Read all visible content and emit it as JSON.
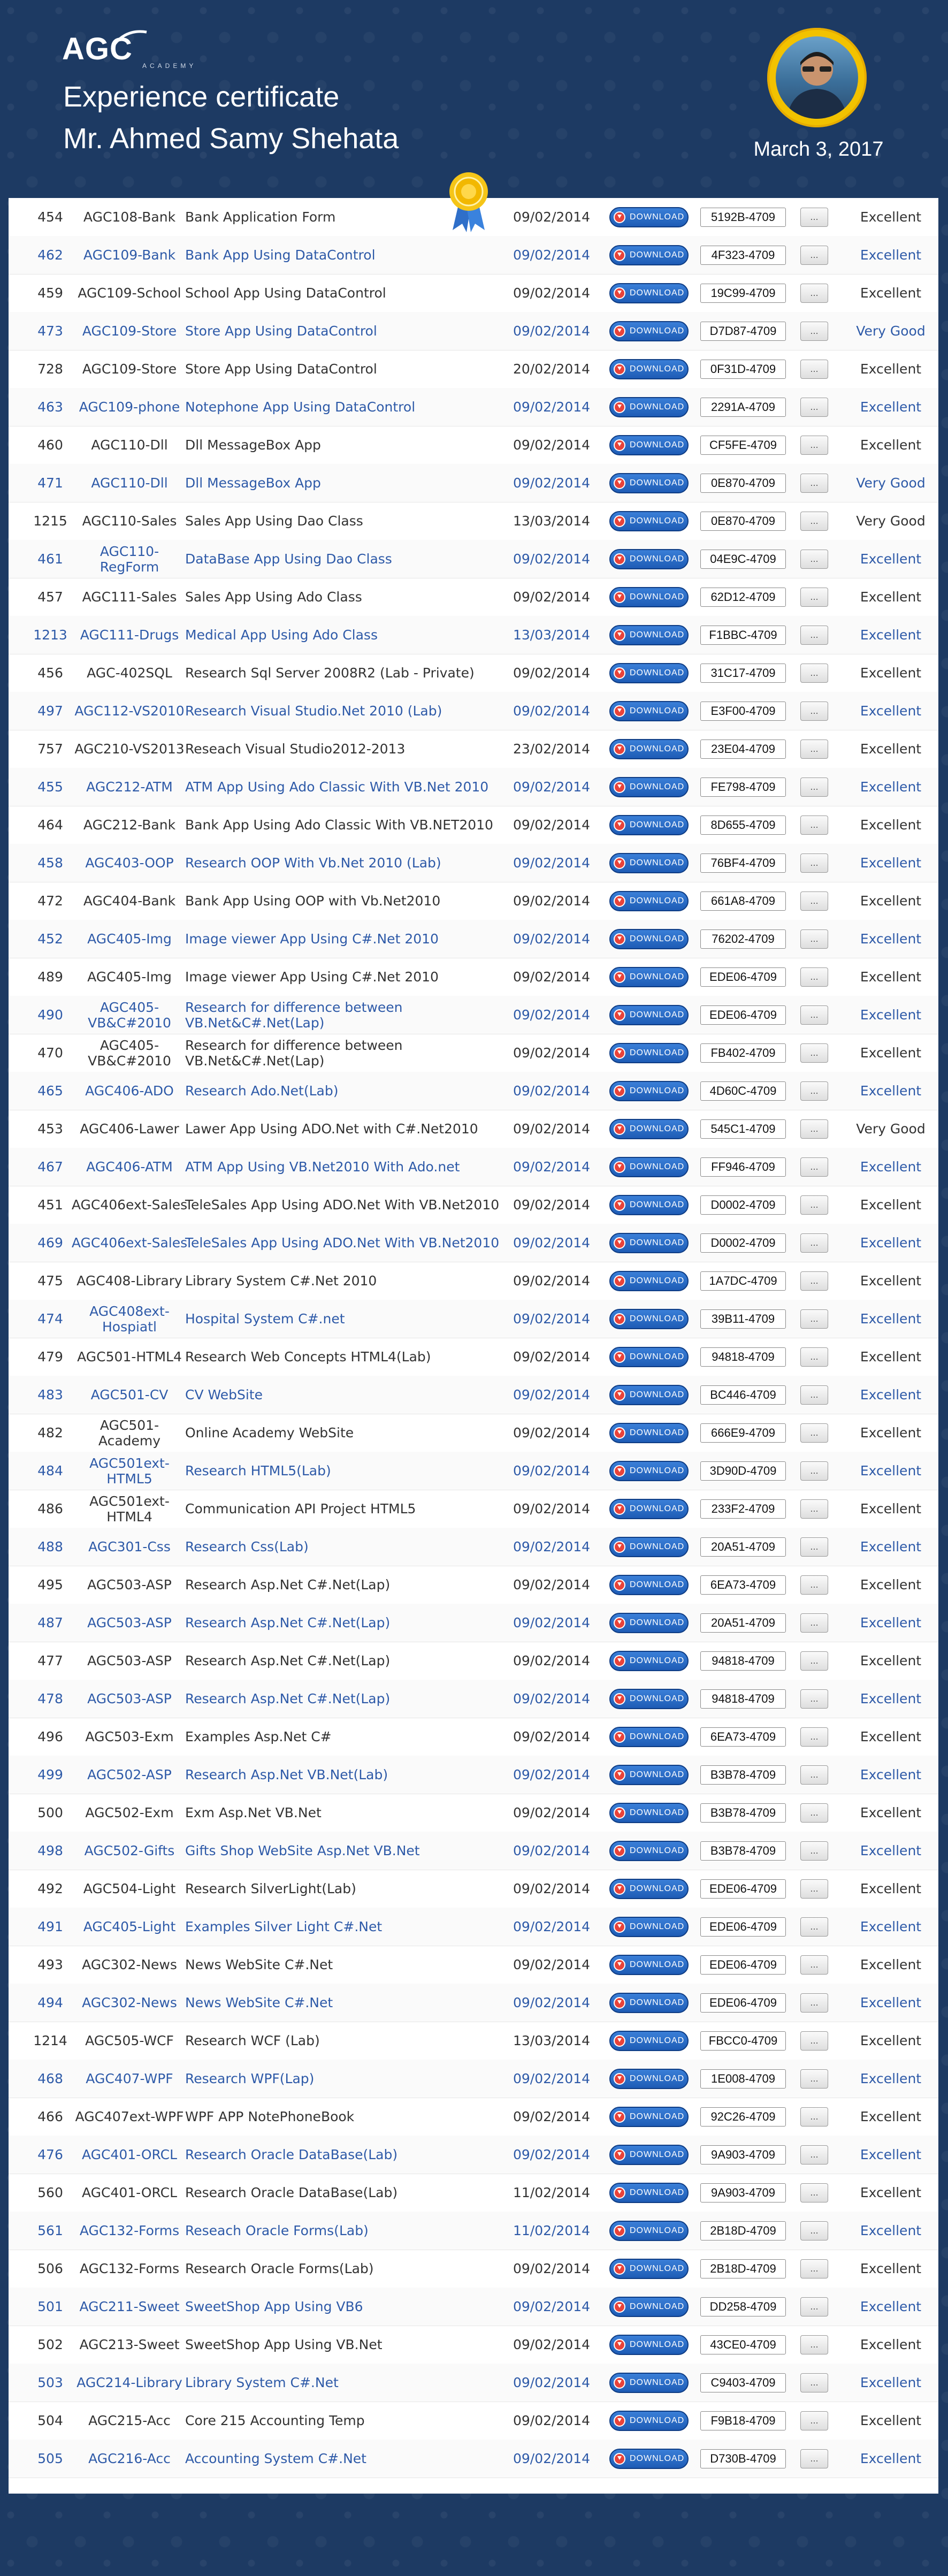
{
  "header": {
    "logo_text": "AGC",
    "logo_sub": "ACADEMY",
    "title_line1": "Experience certificate",
    "title_line2": "Mr. Ahmed Samy Shehata",
    "date": "March 3, 2017"
  },
  "table": {
    "download_label": "DOWNLOAD",
    "more_label": "...",
    "rows": [
      {
        "id": "454",
        "code": "AGC108-Bank",
        "name": "Bank Application Form",
        "date": "09/02/2014",
        "serial": "5192B-4709",
        "grade": "Excellent",
        "blue": false
      },
      {
        "id": "462",
        "code": "AGC109-Bank",
        "name": "Bank App Using DataControl",
        "date": "09/02/2014",
        "serial": "4F323-4709",
        "grade": "Excellent",
        "blue": true
      },
      {
        "id": "459",
        "code": "AGC109-School",
        "name": "School App Using DataControl",
        "date": "09/02/2014",
        "serial": "19C99-4709",
        "grade": "Excellent",
        "blue": false
      },
      {
        "id": "473",
        "code": "AGC109-Store",
        "name": "Store App Using DataControl",
        "date": "09/02/2014",
        "serial": "D7D87-4709",
        "grade": "Very Good",
        "blue": true
      },
      {
        "id": "728",
        "code": "AGC109-Store",
        "name": "Store App Using DataControl",
        "date": "20/02/2014",
        "serial": "0F31D-4709",
        "grade": "Excellent",
        "blue": false
      },
      {
        "id": "463",
        "code": "AGC109-phone",
        "name": "Notephone App Using DataControl",
        "date": "09/02/2014",
        "serial": "2291A-4709",
        "grade": "Excellent",
        "blue": true
      },
      {
        "id": "460",
        "code": "AGC110-Dll",
        "name": "Dll MessageBox App",
        "date": "09/02/2014",
        "serial": "CF5FE-4709",
        "grade": "Excellent",
        "blue": false
      },
      {
        "id": "471",
        "code": "AGC110-Dll",
        "name": "Dll MessageBox App",
        "date": "09/02/2014",
        "serial": "0E870-4709",
        "grade": "Very Good",
        "blue": true
      },
      {
        "id": "1215",
        "code": "AGC110-Sales",
        "name": "Sales App Using Dao Class",
        "date": "13/03/2014",
        "serial": "0E870-4709",
        "grade": "Very Good",
        "blue": false
      },
      {
        "id": "461",
        "code": "AGC110-RegForm",
        "name": "DataBase App Using Dao Class",
        "date": "09/02/2014",
        "serial": "04E9C-4709",
        "grade": "Excellent",
        "blue": true
      },
      {
        "id": "457",
        "code": "AGC111-Sales",
        "name": "Sales App Using Ado Class",
        "date": "09/02/2014",
        "serial": "62D12-4709",
        "grade": "Excellent",
        "blue": false
      },
      {
        "id": "1213",
        "code": "AGC111-Drugs",
        "name": "Medical App Using Ado Class",
        "date": "13/03/2014",
        "serial": "F1BBC-4709",
        "grade": "Excellent",
        "blue": true
      },
      {
        "id": "456",
        "code": "AGC-402SQL",
        "name": "Research Sql Server 2008R2 (Lab - Private)",
        "date": "09/02/2014",
        "serial": "31C17-4709",
        "grade": "Excellent",
        "blue": false
      },
      {
        "id": "497",
        "code": "AGC112-VS2010",
        "name": "Research Visual Studio.Net 2010 (Lab)",
        "date": "09/02/2014",
        "serial": "E3F00-4709",
        "grade": "Excellent",
        "blue": true
      },
      {
        "id": "757",
        "code": "AGC210-VS2013",
        "name": "Reseach Visual Studio2012-2013",
        "date": "23/02/2014",
        "serial": "23E04-4709",
        "grade": "Excellent",
        "blue": false
      },
      {
        "id": "455",
        "code": "AGC212-ATM",
        "name": "ATM App Using Ado Classic With VB.Net 2010",
        "date": "09/02/2014",
        "serial": "FE798-4709",
        "grade": "Excellent",
        "blue": true
      },
      {
        "id": "464",
        "code": "AGC212-Bank",
        "name": "Bank App Using Ado Classic With VB.NET2010",
        "date": "09/02/2014",
        "serial": "8D655-4709",
        "grade": "Excellent",
        "blue": false
      },
      {
        "id": "458",
        "code": "AGC403-OOP",
        "name": "Research OOP With Vb.Net 2010 (Lab)",
        "date": "09/02/2014",
        "serial": "76BF4-4709",
        "grade": "Excellent",
        "blue": true
      },
      {
        "id": "472",
        "code": "AGC404-Bank",
        "name": "Bank App Using OOP with Vb.Net2010",
        "date": "09/02/2014",
        "serial": "661A8-4709",
        "grade": "Excellent",
        "blue": false
      },
      {
        "id": "452",
        "code": "AGC405-Img",
        "name": "Image viewer App Using C#.Net 2010",
        "date": "09/02/2014",
        "serial": "76202-4709",
        "grade": "Excellent",
        "blue": true
      },
      {
        "id": "489",
        "code": "AGC405-Img",
        "name": "Image viewer App Using C#.Net 2010",
        "date": "09/02/2014",
        "serial": "EDE06-4709",
        "grade": "Excellent",
        "blue": false
      },
      {
        "id": "490",
        "code": "AGC405-VB&C#2010",
        "name": "Research for difference between VB.Net&C#.Net(Lap)",
        "date": "09/02/2014",
        "serial": "EDE06-4709",
        "grade": "Excellent",
        "blue": true
      },
      {
        "id": "470",
        "code": "AGC405-VB&C#2010",
        "name": "Research for difference between VB.Net&C#.Net(Lap)",
        "date": "09/02/2014",
        "serial": "FB402-4709",
        "grade": "Excellent",
        "blue": false
      },
      {
        "id": "465",
        "code": "AGC406-ADO",
        "name": "Research Ado.Net(Lab)",
        "date": "09/02/2014",
        "serial": "4D60C-4709",
        "grade": "Excellent",
        "blue": true
      },
      {
        "id": "453",
        "code": "AGC406-Lawer",
        "name": "Lawer App Using ADO.Net with C#.Net2010",
        "date": "09/02/2014",
        "serial": "545C1-4709",
        "grade": "Very Good",
        "blue": false
      },
      {
        "id": "467",
        "code": "AGC406-ATM",
        "name": "ATM App Using VB.Net2010 With Ado.net",
        "date": "09/02/2014",
        "serial": "FF946-4709",
        "grade": "Excellent",
        "blue": true
      },
      {
        "id": "451",
        "code": "AGC406ext-Sales",
        "name": "TeleSales App Using ADO.Net With VB.Net2010",
        "date": "09/02/2014",
        "serial": "D0002-4709",
        "grade": "Excellent",
        "blue": false
      },
      {
        "id": "469",
        "code": "AGC406ext-Sales",
        "name": "TeleSales App Using ADO.Net With VB.Net2010",
        "date": "09/02/2014",
        "serial": "D0002-4709",
        "grade": "Excellent",
        "blue": true
      },
      {
        "id": "475",
        "code": "AGC408-Library",
        "name": "Library System C#.Net 2010",
        "date": "09/02/2014",
        "serial": "1A7DC-4709",
        "grade": "Excellent",
        "blue": false
      },
      {
        "id": "474",
        "code": "AGC408ext-Hospiatl",
        "name": "Hospital System C#.net",
        "date": "09/02/2014",
        "serial": "39B11-4709",
        "grade": "Excellent",
        "blue": true
      },
      {
        "id": "479",
        "code": "AGC501-HTML4",
        "name": "Research Web Concepts HTML4(Lab)",
        "date": "09/02/2014",
        "serial": "94818-4709",
        "grade": "Excellent",
        "blue": false
      },
      {
        "id": "483",
        "code": "AGC501-CV",
        "name": "CV WebSite",
        "date": "09/02/2014",
        "serial": "BC446-4709",
        "grade": "Excellent",
        "blue": true
      },
      {
        "id": "482",
        "code": "AGC501-Academy",
        "name": "Online Academy WebSite",
        "date": "09/02/2014",
        "serial": "666E9-4709",
        "grade": "Excellent",
        "blue": false
      },
      {
        "id": "484",
        "code": "AGC501ext-HTML5",
        "name": "Research HTML5(Lab)",
        "date": "09/02/2014",
        "serial": "3D90D-4709",
        "grade": "Excellent",
        "blue": true
      },
      {
        "id": "486",
        "code": "AGC501ext-HTML4",
        "name": "Communication API Project HTML5",
        "date": "09/02/2014",
        "serial": "233F2-4709",
        "grade": "Excellent",
        "blue": false
      },
      {
        "id": "488",
        "code": "AGC301-Css",
        "name": "Research Css(Lab)",
        "date": "09/02/2014",
        "serial": "20A51-4709",
        "grade": "Excellent",
        "blue": true
      },
      {
        "id": "495",
        "code": "AGC503-ASP",
        "name": "Research Asp.Net C#.Net(Lap)",
        "date": "09/02/2014",
        "serial": "6EA73-4709",
        "grade": "Excellent",
        "blue": false
      },
      {
        "id": "487",
        "code": "AGC503-ASP",
        "name": "Research Asp.Net C#.Net(Lap)",
        "date": "09/02/2014",
        "serial": "20A51-4709",
        "grade": "Excellent",
        "blue": true
      },
      {
        "id": "477",
        "code": "AGC503-ASP",
        "name": "Research Asp.Net C#.Net(Lap)",
        "date": "09/02/2014",
        "serial": "94818-4709",
        "grade": "Excellent",
        "blue": false
      },
      {
        "id": "478",
        "code": "AGC503-ASP",
        "name": "Research Asp.Net C#.Net(Lap)",
        "date": "09/02/2014",
        "serial": "94818-4709",
        "grade": "Excellent",
        "blue": true
      },
      {
        "id": "496",
        "code": "AGC503-Exm",
        "name": "Examples Asp.Net C#",
        "date": "09/02/2014",
        "serial": "6EA73-4709",
        "grade": "Excellent",
        "blue": false
      },
      {
        "id": "499",
        "code": "AGC502-ASP",
        "name": "Research Asp.Net VB.Net(Lab)",
        "date": "09/02/2014",
        "serial": "B3B78-4709",
        "grade": "Excellent",
        "blue": true
      },
      {
        "id": "500",
        "code": "AGC502-Exm",
        "name": "Exm Asp.Net VB.Net",
        "date": "09/02/2014",
        "serial": "B3B78-4709",
        "grade": "Excellent",
        "blue": false
      },
      {
        "id": "498",
        "code": "AGC502-Gifts",
        "name": "Gifts Shop WebSite Asp.Net VB.Net",
        "date": "09/02/2014",
        "serial": "B3B78-4709",
        "grade": "Excellent",
        "blue": true
      },
      {
        "id": "492",
        "code": "AGC504-Light",
        "name": "Research SilverLight(Lab)",
        "date": "09/02/2014",
        "serial": "EDE06-4709",
        "grade": "Excellent",
        "blue": false
      },
      {
        "id": "491",
        "code": "AGC405-Light",
        "name": "Examples Silver Light C#.Net",
        "date": "09/02/2014",
        "serial": "EDE06-4709",
        "grade": "Excellent",
        "blue": true
      },
      {
        "id": "493",
        "code": "AGC302-News",
        "name": "News WebSite C#.Net",
        "date": "09/02/2014",
        "serial": "EDE06-4709",
        "grade": "Excellent",
        "blue": false
      },
      {
        "id": "494",
        "code": "AGC302-News",
        "name": "News WebSite C#.Net",
        "date": "09/02/2014",
        "serial": "EDE06-4709",
        "grade": "Excellent",
        "blue": true
      },
      {
        "id": "1214",
        "code": "AGC505-WCF",
        "name": "Research WCF (Lab)",
        "date": "13/03/2014",
        "serial": "FBCC0-4709",
        "grade": "Excellent",
        "blue": false
      },
      {
        "id": "468",
        "code": "AGC407-WPF",
        "name": "Research WPF(Lap)",
        "date": "09/02/2014",
        "serial": "1E008-4709",
        "grade": "Excellent",
        "blue": true
      },
      {
        "id": "466",
        "code": "AGC407ext-WPF",
        "name": "WPF APP NotePhoneBook",
        "date": "09/02/2014",
        "serial": "92C26-4709",
        "grade": "Excellent",
        "blue": false
      },
      {
        "id": "476",
        "code": "AGC401-ORCL",
        "name": "Research Oracle DataBase(Lab)",
        "date": "09/02/2014",
        "serial": "9A903-4709",
        "grade": "Excellent",
        "blue": true
      },
      {
        "id": "560",
        "code": "AGC401-ORCL",
        "name": "Research Oracle DataBase(Lab)",
        "date": "11/02/2014",
        "serial": "9A903-4709",
        "grade": "Excellent",
        "blue": false
      },
      {
        "id": "561",
        "code": "AGC132-Forms",
        "name": "Reseach Oracle Forms(Lab)",
        "date": "11/02/2014",
        "serial": "2B18D-4709",
        "grade": "Excellent",
        "blue": true
      },
      {
        "id": "506",
        "code": "AGC132-Forms",
        "name": "Research Oracle Forms(Lab)",
        "date": "09/02/2014",
        "serial": "2B18D-4709",
        "grade": "Excellent",
        "blue": false
      },
      {
        "id": "501",
        "code": "AGC211-Sweet",
        "name": "SweetShop App Using VB6",
        "date": "09/02/2014",
        "serial": "DD258-4709",
        "grade": "Excellent",
        "blue": true
      },
      {
        "id": "502",
        "code": "AGC213-Sweet",
        "name": "SweetShop App Using VB.Net",
        "date": "09/02/2014",
        "serial": "43CE0-4709",
        "grade": "Excellent",
        "blue": false
      },
      {
        "id": "503",
        "code": "AGC214-Library",
        "name": "Library System C#.Net",
        "date": "09/02/2014",
        "serial": "C9403-4709",
        "grade": "Excellent",
        "blue": true
      },
      {
        "id": "504",
        "code": "AGC215-Acc",
        "name": "Core 215 Accounting Temp",
        "date": "09/02/2014",
        "serial": "F9B18-4709",
        "grade": "Excellent",
        "blue": false
      },
      {
        "id": "505",
        "code": "AGC216-Acc",
        "name": "Accounting System C#.Net",
        "date": "09/02/2014",
        "serial": "D730B-4709",
        "grade": "Excellent",
        "blue": true
      }
    ]
  },
  "colors": {
    "background": "#1d3a63",
    "blue_text": "#2e5aa8",
    "badge_gold": "#f2c200"
  }
}
